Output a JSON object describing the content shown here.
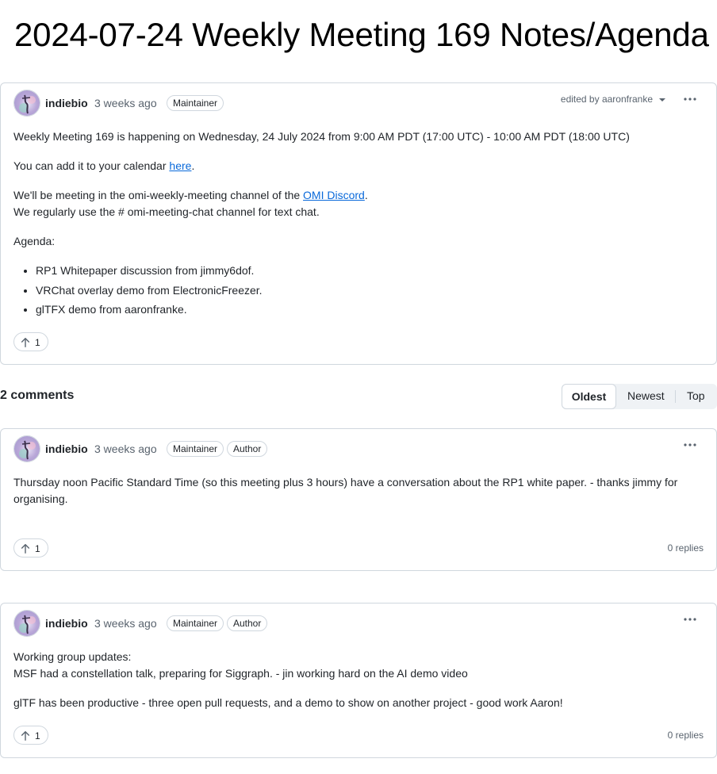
{
  "page": {
    "title": "2024-07-24 Weekly Meeting 169 Notes/Agenda"
  },
  "post": {
    "author": "indiebio",
    "time": "3 weeks ago",
    "badges": [
      "Maintainer"
    ],
    "edited_prefix": "edited by",
    "edited_by": "aaronfranke",
    "body": {
      "line1": "Weekly Meeting 169 is happening on Wednesday, 24 July 2024 from 9:00 AM PDT (17:00 UTC) - 10:00 AM PDT (18:00 UTC)",
      "calendar_prefix": "You can add it to your calendar ",
      "calendar_link": "here",
      "calendar_suffix": ".",
      "channel_prefix": "We'll be meeting in the omi-weekly-meeting channel of the ",
      "channel_link": "OMI Discord",
      "channel_suffix": ".",
      "text_chat": "We regularly use the # omi-meeting-chat channel for text chat.",
      "agenda_label": "Agenda:",
      "agenda": [
        "RP1 Whitepaper discussion from jimmy6dof.",
        "VRChat overlay demo from ElectronicFreezer.",
        "glTFX demo from aaronfranke."
      ]
    },
    "upvotes": "1"
  },
  "comments": {
    "count_label": "2 comments",
    "sort": {
      "oldest": "Oldest",
      "newest": "Newest",
      "top": "Top",
      "selected": "Oldest"
    },
    "items": [
      {
        "author": "indiebio",
        "time": "3 weeks ago",
        "badges": [
          "Maintainer",
          "Author"
        ],
        "body": "Thursday noon Pacific Standard Time (so this meeting plus 3 hours) have a conversation about the RP1 white paper. - thanks jimmy for organising.",
        "upvotes": "1",
        "replies": "0 replies"
      },
      {
        "author": "indiebio",
        "time": "3 weeks ago",
        "badges": [
          "Maintainer",
          "Author"
        ],
        "body_line1": "Working group updates:",
        "body_line2": "MSF had a constellation talk, preparing for Siggraph. - jin working hard on the AI demo video",
        "body_line3": "glTF has been productive - three open pull requests, and a demo to show on another project - good work Aaron!",
        "upvotes": "1",
        "replies": "0 replies"
      }
    ]
  },
  "icons": {
    "avatar": "avatar-image",
    "kebab": "kebab-horizontal-icon",
    "upvote": "arrow-up-icon",
    "caret": "triangle-down-icon"
  },
  "colors": {
    "link": "#0969da",
    "border": "#d0d7de",
    "muted": "#59636e"
  }
}
